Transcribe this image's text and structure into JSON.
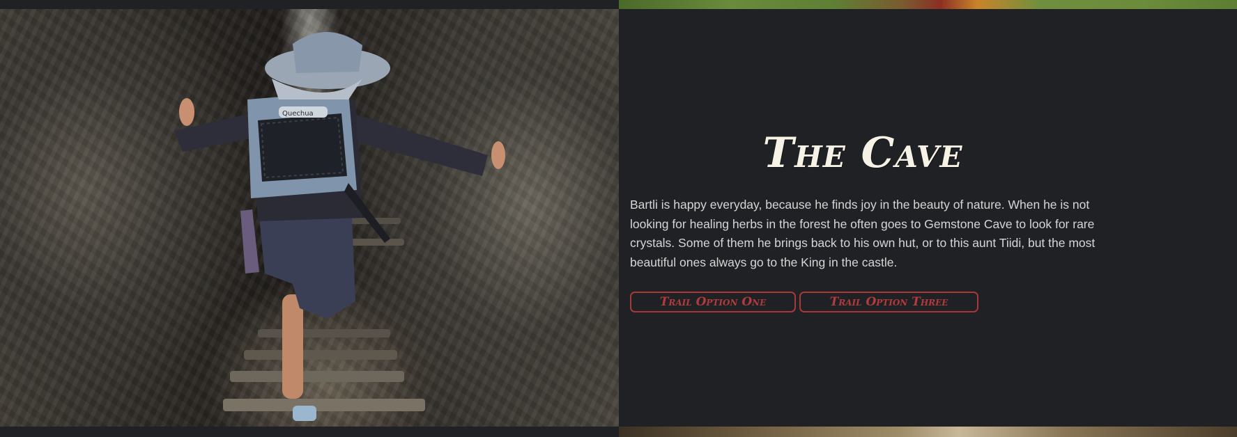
{
  "section": {
    "title": "The Cave",
    "description": "Bartli is happy everyday, because he finds joy in the beauty of nature. When he is not looking for healing herbs in the forest he often goes to Gemstone Cave to look for rare crystals. Some of them he brings back to his own hut, or to this aunt Tiidi, but the most beautiful ones always go to the King in the castle.",
    "buttons": [
      {
        "label": "Trail Option One"
      },
      {
        "label": "Trail Option Three"
      }
    ],
    "photo": {
      "backpack_text": "Quechua"
    }
  },
  "colors": {
    "background": "#202124",
    "title": "#f6f2e6",
    "text": "#d6d6d6",
    "accent": "#a8393b"
  }
}
